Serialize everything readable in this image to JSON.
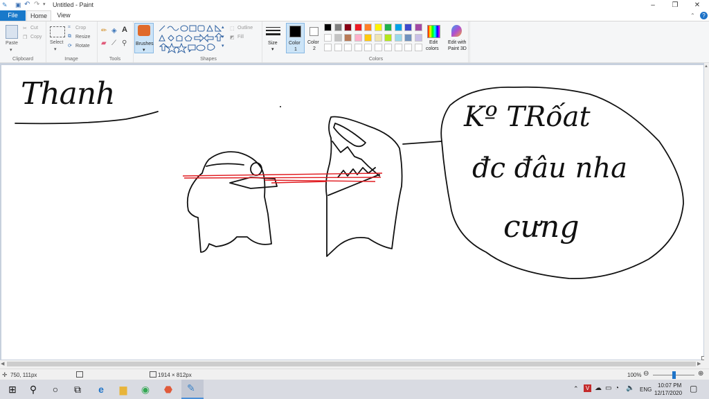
{
  "window": {
    "title": "Untitled - Paint",
    "minimize_glyph": "–",
    "maximize_glyph": "❐",
    "close_glyph": "✕"
  },
  "tabs": {
    "file": "File",
    "home": "Home",
    "view": "View"
  },
  "ribbon": {
    "clipboard": {
      "label": "Clipboard",
      "paste": "Paste",
      "cut": "Cut",
      "copy": "Copy"
    },
    "image": {
      "label": "Image",
      "select": "Select",
      "crop": "Crop",
      "resize": "Resize",
      "rotate": "Rotate"
    },
    "tools": {
      "label": "Tools",
      "text_glyph": "A"
    },
    "brushes": {
      "label": "Brushes"
    },
    "shapes": {
      "label": "Shapes",
      "outline": "Outline",
      "fill": "Fill"
    },
    "size": {
      "label": "Size"
    },
    "color1": {
      "label": "Color",
      "sub": "1",
      "value": "#000000"
    },
    "color2": {
      "label": "Color",
      "sub": "2",
      "value": "#ffffff"
    },
    "colors": {
      "label": "Colors",
      "edit": "Edit",
      "edit2": "colors"
    },
    "paint3d": {
      "label": "Edit with",
      "label2": "Paint 3D"
    },
    "palette_row1": [
      "#000000",
      "#7f7f7f",
      "#880015",
      "#ed1c24",
      "#ff7f27",
      "#fff200",
      "#22b14c",
      "#00a2e8",
      "#3f48cc",
      "#a349a4"
    ],
    "palette_row2": [
      "#ffffff",
      "#c3c3c3",
      "#b97a57",
      "#ffaec9",
      "#ffc90e",
      "#efe4b0",
      "#b5e61d",
      "#99d9ea",
      "#7092be",
      "#c8bfe7"
    ]
  },
  "drawing": {
    "name_text": "Thanh",
    "bubble_line1": "Kº TRốat",
    "bubble_line2": "đc đâu nha",
    "bubble_line3": "cưng",
    "laser_color": "#e0191e"
  },
  "status": {
    "cursor": "750, 111px",
    "dimensions": "1914 × 812px",
    "zoom": "100%"
  },
  "taskbar": {
    "lang": "ENG",
    "time": "10:07 PM",
    "date": "12/17/2020"
  }
}
